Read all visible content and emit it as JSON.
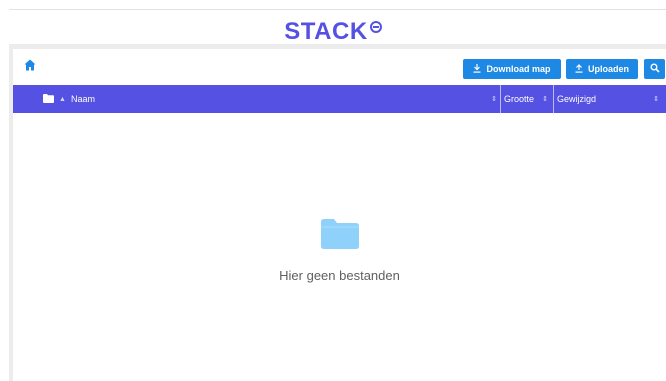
{
  "brand": {
    "name": "STACK",
    "color": "#5551e3"
  },
  "toolbar": {
    "download_label": "Download map",
    "upload_label": "Uploaden",
    "accent": "#1e88e5"
  },
  "table": {
    "header_bg": "#5551e3",
    "columns": [
      {
        "label": "Naam",
        "sort": "⇕"
      },
      {
        "label": "Grootte",
        "sort": "⇕"
      },
      {
        "label": "Gewijzigd",
        "sort": "⇕"
      }
    ],
    "folder_sort": "▲"
  },
  "empty_state": {
    "icon": "folder-icon",
    "message": "Hier geen bestanden"
  }
}
